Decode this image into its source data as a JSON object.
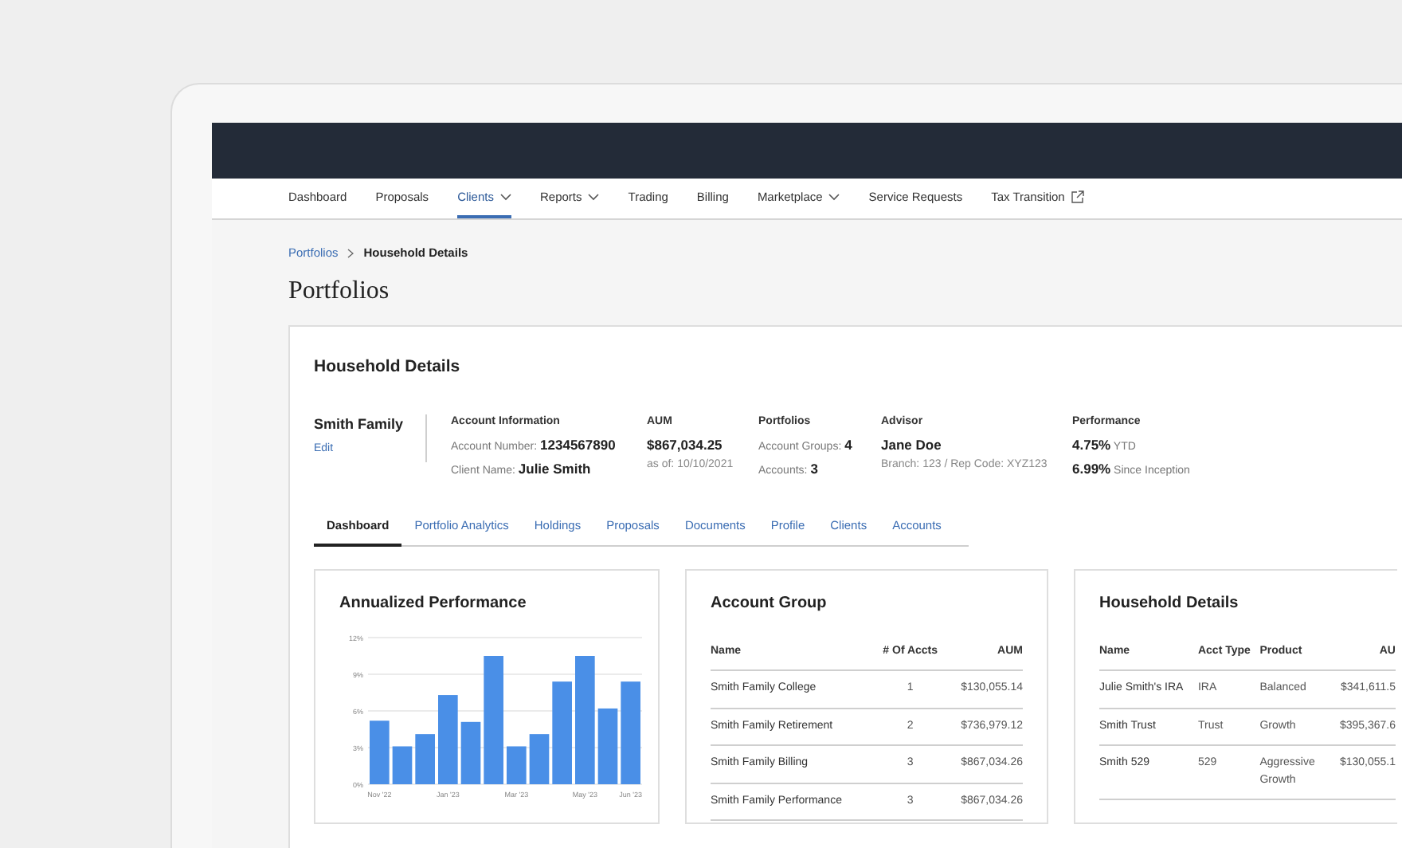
{
  "nav": [
    {
      "label": "Dashboard",
      "selected": false,
      "dropdown": false,
      "external": false
    },
    {
      "label": "Proposals",
      "selected": false,
      "dropdown": false,
      "external": false
    },
    {
      "label": "Clients",
      "selected": true,
      "dropdown": true,
      "external": false
    },
    {
      "label": "Reports",
      "selected": false,
      "dropdown": true,
      "external": false
    },
    {
      "label": "Trading",
      "selected": false,
      "dropdown": false,
      "external": false
    },
    {
      "label": "Billing",
      "selected": false,
      "dropdown": false,
      "external": false
    },
    {
      "label": "Marketplace",
      "selected": false,
      "dropdown": true,
      "external": false
    },
    {
      "label": "Service Requests",
      "selected": false,
      "dropdown": false,
      "external": false
    },
    {
      "label": "Tax Transition",
      "selected": false,
      "dropdown": false,
      "external": true
    }
  ],
  "breadcrumb": [
    {
      "label": "Portfolios",
      "kind": "link"
    },
    {
      "label": "Household Details",
      "kind": "current"
    }
  ],
  "page_title": "Portfolios",
  "card_title": "Household Details",
  "household": {
    "name": "Smith Family",
    "edit": "Edit"
  },
  "info": [
    {
      "title": "Account Information",
      "lines": [
        {
          "kind": "pair",
          "label": "Account Number:",
          "value": "1234567890"
        },
        {
          "kind": "pair",
          "label": "Client Name:",
          "value": "Julie Smith"
        }
      ]
    },
    {
      "title": "AUM",
      "lines": [
        {
          "kind": "big",
          "text": "$867,034.25"
        },
        {
          "kind": "note",
          "text": "as of: 10/10/2021"
        }
      ]
    },
    {
      "title": "Portfolios",
      "lines": [
        {
          "kind": "pair",
          "label": "Account Groups:",
          "value": "4"
        },
        {
          "kind": "pair",
          "label": "Accounts:",
          "value": "3"
        }
      ]
    },
    {
      "title": "Advisor",
      "lines": [
        {
          "kind": "big",
          "text": "Jane Doe"
        },
        {
          "kind": "note",
          "text": "Branch: 123 / Rep Code: XYZ123"
        }
      ]
    },
    {
      "title": "Performance",
      "lines": [
        {
          "kind": "stat",
          "value": "4.75%",
          "label": "YTD"
        },
        {
          "kind": "stat",
          "value": "6.99%",
          "label": "Since Inception"
        }
      ]
    }
  ],
  "tabs": [
    {
      "label": "Dashboard",
      "selected": true
    },
    {
      "label": "Portfolio Analytics",
      "selected": false
    },
    {
      "label": "Holdings",
      "selected": false
    },
    {
      "label": "Proposals",
      "selected": false
    },
    {
      "label": "Documents",
      "selected": false
    },
    {
      "label": "Profile",
      "selected": false
    },
    {
      "label": "Clients",
      "selected": false
    },
    {
      "label": "Accounts",
      "selected": false
    }
  ],
  "performance": {
    "title": "Annualized Performance",
    "chart_data": {
      "type": "bar",
      "categories": [
        "Nov '22",
        null,
        null,
        "Jan '23",
        null,
        null,
        "Mar '23",
        null,
        null,
        "May '23",
        null,
        "Jun '23"
      ],
      "grid": true,
      "series": [
        {
          "color": "#4a8fe7",
          "values": [
            5.2,
            3.1,
            4.1,
            7.3,
            5.1,
            10.5,
            3.1,
            4.1,
            8.4,
            10.5,
            6.2,
            8.4
          ]
        }
      ],
      "ylim": [
        0,
        12
      ],
      "yticks": [
        {
          "value": 0,
          "label": "0%"
        },
        {
          "value": 3,
          "label": "3%"
        },
        {
          "value": 6,
          "label": "6%"
        },
        {
          "value": 9,
          "label": "9%"
        },
        {
          "value": 12,
          "label": "12%"
        }
      ]
    }
  },
  "account_group": {
    "title": "Account Group",
    "columns": [
      "Name",
      "# Of Accts",
      "AUM"
    ],
    "rows": [
      [
        "Smith Family College",
        "1",
        "$130,055.14"
      ],
      [
        "Smith Family Retirement",
        "2",
        "$736,979.12"
      ],
      [
        "Smith Family Billing",
        "3",
        "$867,034.26"
      ],
      [
        "Smith Family Performance",
        "3",
        "$867,034.26"
      ]
    ]
  },
  "household_details": {
    "title": "Household Details",
    "columns": [
      "Name",
      "Acct Type",
      "Product",
      "AU"
    ],
    "rows": [
      [
        "Julie Smith's IRA",
        "IRA",
        "Balanced",
        "$341,611.5"
      ],
      [
        "Smith Trust",
        "Trust",
        "Growth",
        "$395,367.6"
      ],
      [
        "Smith 529",
        "529",
        "Aggressive Growth",
        "$130,055.1"
      ]
    ]
  }
}
